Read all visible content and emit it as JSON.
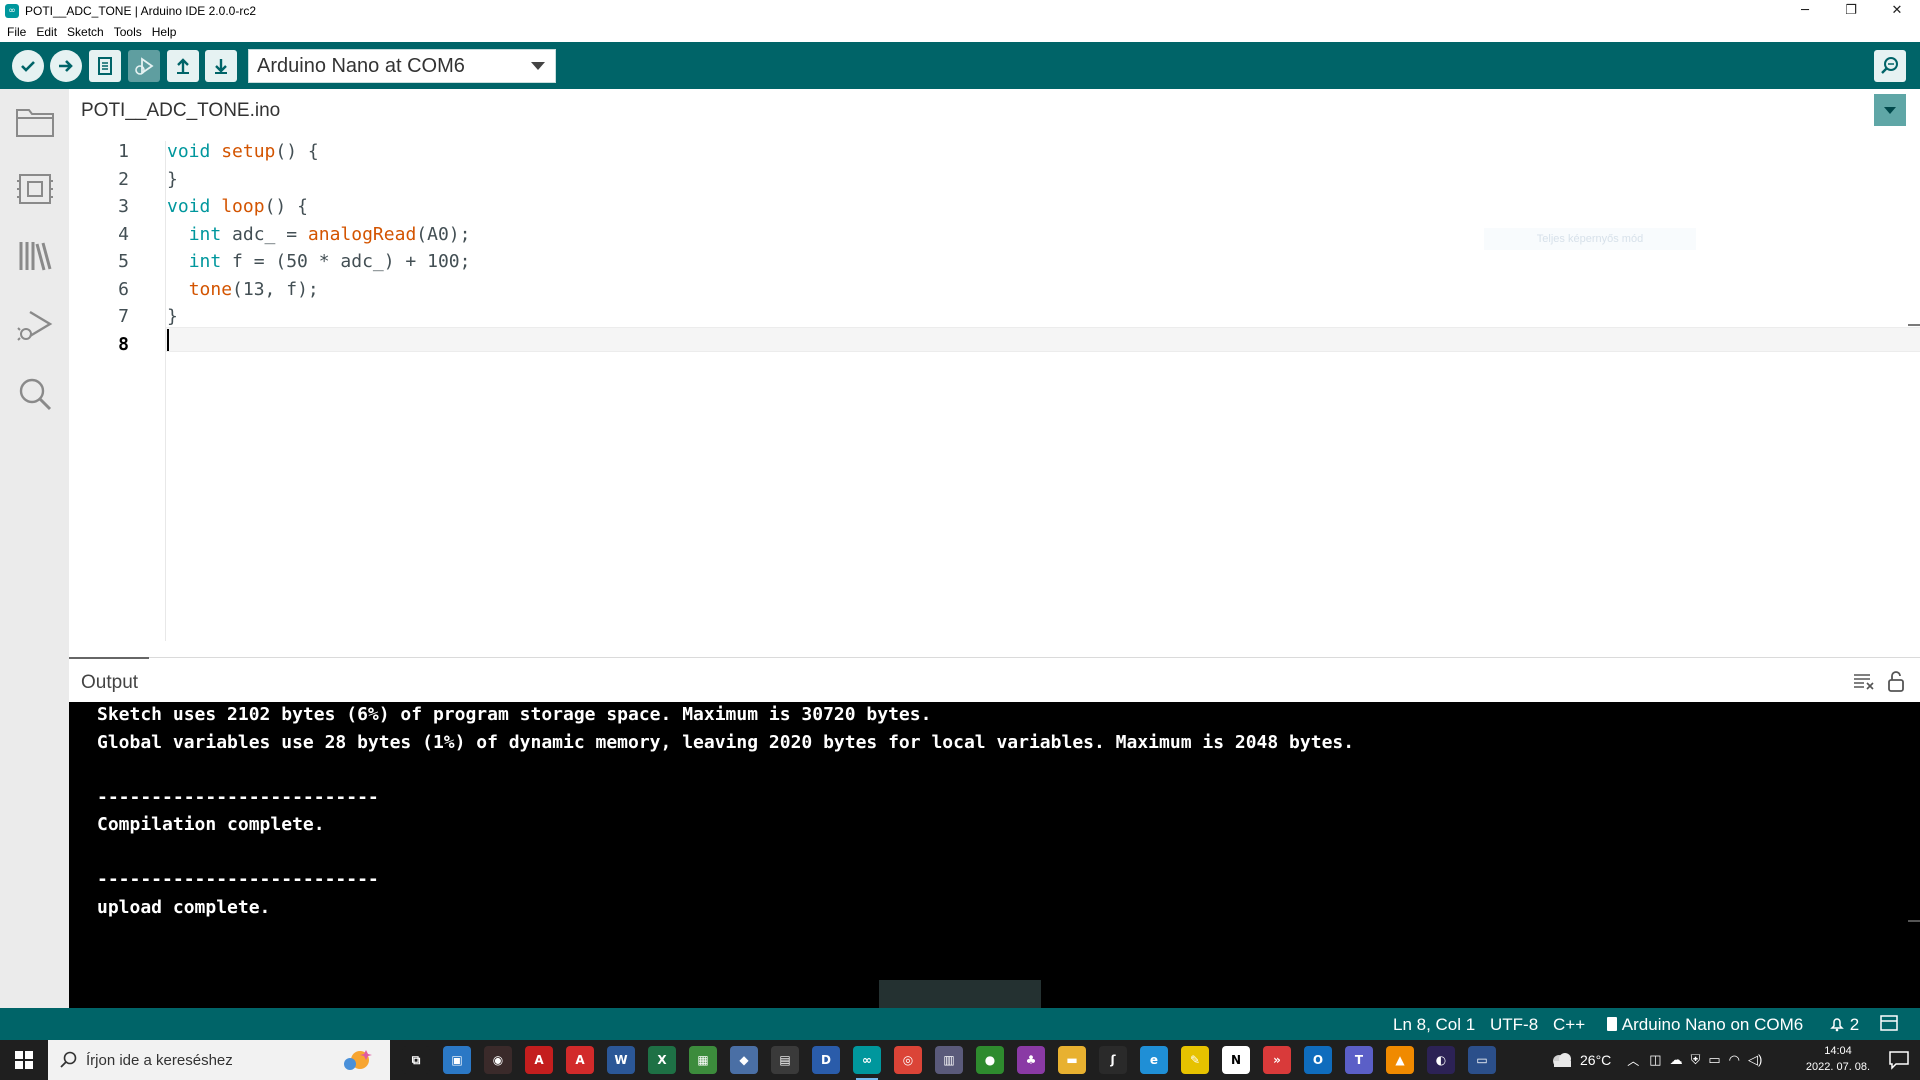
{
  "window": {
    "title": "POTI__ADC_TONE | Arduino IDE 2.0.0-rc2",
    "minimize": "─",
    "restore": "❐",
    "close": "✕"
  },
  "menu": [
    "File",
    "Edit",
    "Sketch",
    "Tools",
    "Help"
  ],
  "toolbar": {
    "board": "Arduino Nano at COM6",
    "icons": [
      "verify-icon",
      "upload-icon",
      "new-sketch-icon",
      "debug-icon",
      "open-icon",
      "save-icon",
      "serial-monitor-icon"
    ]
  },
  "sidebar": {
    "icons": [
      "sketchbook-folder-icon",
      "boards-manager-icon",
      "library-manager-icon",
      "debug-icon",
      "search-icon"
    ]
  },
  "editor": {
    "tab": "POTI__ADC_TONE.ino",
    "ghost_tooltip": "Teljes képernyős mód",
    "line_numbers": [
      "1",
      "2",
      "3",
      "4",
      "5",
      "6",
      "7",
      "8"
    ],
    "lines": [
      {
        "segments": [
          {
            "t": "void",
            "c": "kw"
          },
          {
            "t": " "
          },
          {
            "t": "setup",
            "c": "fn"
          },
          {
            "t": "() {"
          }
        ]
      },
      {
        "segments": [
          {
            "t": "}"
          }
        ]
      },
      {
        "segments": [
          {
            "t": "void",
            "c": "kw"
          },
          {
            "t": " "
          },
          {
            "t": "loop",
            "c": "fn"
          },
          {
            "t": "() {"
          }
        ]
      },
      {
        "segments": [
          {
            "t": "  "
          },
          {
            "t": "int",
            "c": "kw"
          },
          {
            "t": " adc_ = "
          },
          {
            "t": "analogRead",
            "c": "fn"
          },
          {
            "t": "(A0);"
          }
        ]
      },
      {
        "segments": [
          {
            "t": "  "
          },
          {
            "t": "int",
            "c": "kw"
          },
          {
            "t": " f = (50 * adc_) + 100;"
          }
        ]
      },
      {
        "segments": [
          {
            "t": "  "
          },
          {
            "t": "tone",
            "c": "fn"
          },
          {
            "t": "(13, f);"
          }
        ]
      },
      {
        "segments": [
          {
            "t": "}"
          }
        ]
      },
      {
        "segments": [
          {
            "t": ""
          }
        ]
      }
    ],
    "current_line": 8
  },
  "output": {
    "title": "Output",
    "lines": [
      "Sketch uses 2102 bytes (6%) of program storage space. Maximum is 30720 bytes.",
      "Global variables use 28 bytes (1%) of dynamic memory, leaving 2020 bytes for local variables. Maximum is 2048 bytes.",
      "",
      "--------------------------",
      "Compilation complete.",
      "",
      "--------------------------",
      "upload complete."
    ]
  },
  "status": {
    "position": "Ln 8, Col 1",
    "encoding": "UTF-8",
    "language": "C++",
    "board": "Arduino Nano on COM6",
    "notifications": "2"
  },
  "taskbar": {
    "search_placeholder": "Írjon ide a kereséshez",
    "weather": "26°C",
    "time": "14:04",
    "date": "2022. 07. 08.",
    "apps": [
      {
        "name": "task-view-icon",
        "color": "#1f1f1f",
        "label": "⧉"
      },
      {
        "name": "app-icon-1",
        "color": "#2b78c5",
        "label": "▣"
      },
      {
        "name": "app-icon-2",
        "color": "#3a2a2a",
        "label": "◉"
      },
      {
        "name": "acrobat-icon",
        "color": "#c41e1e",
        "label": "A"
      },
      {
        "name": "autocad-icon",
        "color": "#d22a2a",
        "label": "A"
      },
      {
        "name": "word-icon",
        "color": "#2b5797",
        "label": "W"
      },
      {
        "name": "excel-icon",
        "color": "#1e7145",
        "label": "X"
      },
      {
        "name": "app-icon-3",
        "color": "#3c8c3c",
        "label": "▦"
      },
      {
        "name": "app-icon-4",
        "color": "#4a6fa5",
        "label": "◆"
      },
      {
        "name": "calculator-icon",
        "color": "#3a3a3a",
        "label": "▤"
      },
      {
        "name": "devcpp-icon",
        "color": "#2a5caa",
        "label": "D"
      },
      {
        "name": "arduino-icon",
        "color": "#00979d",
        "label": "∞"
      },
      {
        "name": "chrome-icon",
        "color": "#db4437",
        "label": "◎"
      },
      {
        "name": "app-icon-5",
        "color": "#5a5a7a",
        "label": "▥"
      },
      {
        "name": "app-icon-6",
        "color": "#2e8b2e",
        "label": "●"
      },
      {
        "name": "app-icon-7",
        "color": "#8a3aa5",
        "label": "♣"
      },
      {
        "name": "file-explorer-icon",
        "color": "#e8b130",
        "label": "▬"
      },
      {
        "name": "app-icon-8",
        "color": "#2a2a2a",
        "label": "ʃ"
      },
      {
        "name": "edge-icon",
        "color": "#1f8fd6",
        "label": "e"
      },
      {
        "name": "app-icon-9",
        "color": "#e6c200",
        "label": "✎"
      },
      {
        "name": "notion-icon",
        "color": "#ffffff",
        "label": "N"
      },
      {
        "name": "app-icon-10",
        "color": "#d93a3a",
        "label": "»"
      },
      {
        "name": "outlook-icon",
        "color": "#0f6cbd",
        "label": "O"
      },
      {
        "name": "teams-icon",
        "color": "#5b5fc7",
        "label": "T"
      },
      {
        "name": "vlc-icon",
        "color": "#f08a00",
        "label": "▲"
      },
      {
        "name": "eclipse-icon",
        "color": "#2c2255",
        "label": "◐"
      },
      {
        "name": "app-icon-11",
        "color": "#2b4f8a",
        "label": "▭"
      }
    ]
  }
}
